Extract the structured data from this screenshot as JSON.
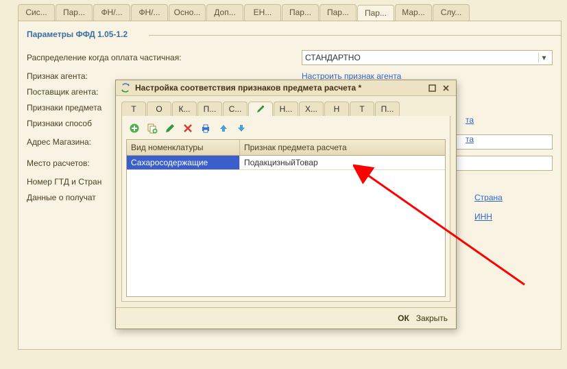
{
  "outer_tabs": [
    {
      "label": "Сис..."
    },
    {
      "label": "Пар..."
    },
    {
      "label": "ФН/..."
    },
    {
      "label": "ФН/..."
    },
    {
      "label": "Осно..."
    },
    {
      "label": "Доп..."
    },
    {
      "label": "ЕН..."
    },
    {
      "label": "Пар..."
    },
    {
      "label": "Пар..."
    },
    {
      "label": "Пар...",
      "active": true
    },
    {
      "label": "Мар..."
    },
    {
      "label": "Слу..."
    }
  ],
  "legend": "Параметры ФФД 1.05-1.2",
  "rows": {
    "r0": {
      "label": "Распределение когда оплата частичная:",
      "value": "СТАНДАРТНО"
    },
    "r1": {
      "label": "Признак агента:",
      "link": "Настроить признак агента"
    },
    "r2": {
      "label": "Поставщик агента:"
    },
    "r3": {
      "label": "Признаки предмета",
      "link": "та"
    },
    "r4": {
      "label": "Признаки способ",
      "link": "та"
    },
    "r5": {
      "label": "Адрес Магазина:"
    },
    "r6": {
      "label": "Место расчетов:"
    },
    "r7": {
      "label": "Номер ГТД и Стран",
      "link": "Страна"
    },
    "r8": {
      "label": "Данные о получат",
      "link": "ИНН"
    }
  },
  "dialog": {
    "title": "Настройка соответствия признаков предмета расчета *",
    "tabs": [
      {
        "label": "Т"
      },
      {
        "label": "О"
      },
      {
        "label": "К..."
      },
      {
        "label": "П..."
      },
      {
        "label": "С..."
      },
      {
        "label": "",
        "icon": "pencil",
        "active": true
      },
      {
        "label": "Н..."
      },
      {
        "label": "Х..."
      },
      {
        "label": "Н"
      },
      {
        "label": "Т"
      },
      {
        "label": "П..."
      }
    ],
    "grid": {
      "headers": {
        "c1": "Вид номенклатуры",
        "c2": "Признак предмета расчета"
      },
      "row0": {
        "c1": "Сахаросодержащие",
        "c2": "ПодакцизныйТовар"
      }
    },
    "buttons": {
      "ok": "ОК",
      "close": "Закрыть"
    }
  }
}
